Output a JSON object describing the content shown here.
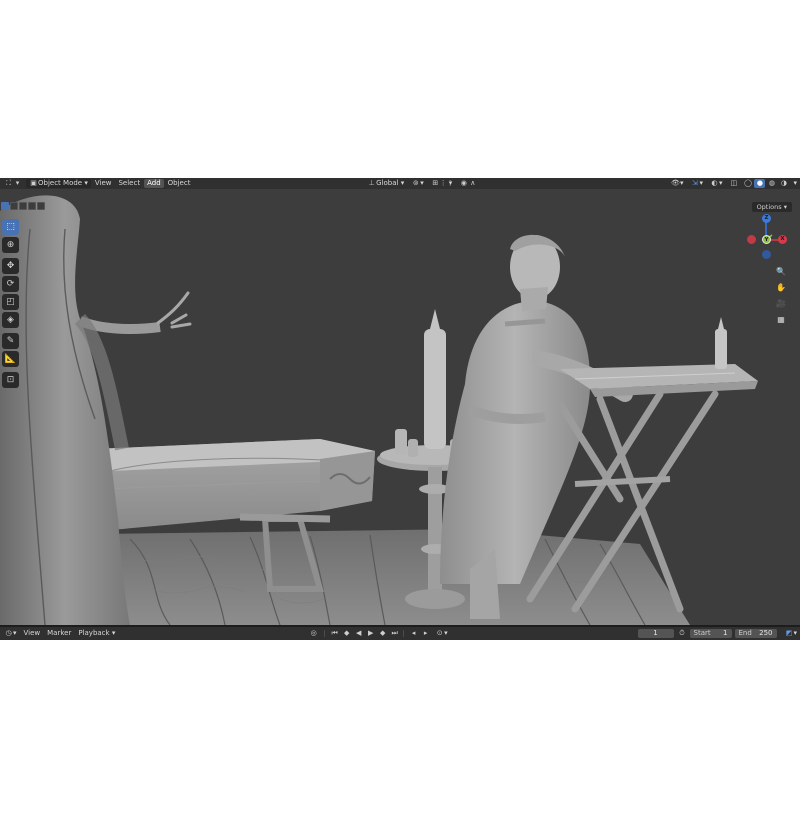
{
  "header": {
    "editor_type_icon": "editor-type-icon",
    "mode": "Object Mode",
    "menus": [
      "View",
      "Select",
      "Add",
      "Object"
    ],
    "active_menu": "Add",
    "transform_orientation": "Global"
  },
  "viewport": {
    "options_label": "Options",
    "gizmo": {
      "x": "X",
      "y": "Y",
      "z": "Z",
      "x_color": "#d83a4a",
      "y_color": "#8cc03c",
      "z_color": "#3a7ae0"
    }
  },
  "toolbar": {
    "tools": [
      "select-box",
      "cursor",
      "move",
      "rotate",
      "scale",
      "transform",
      "annotate",
      "measure",
      "add-cube"
    ],
    "active_tool": "select-box"
  },
  "timeline": {
    "menus": [
      "View",
      "Marker",
      "Playback"
    ],
    "current_frame": "1",
    "start_label": "Start",
    "start_value": "1",
    "end_label": "End",
    "end_value": "250"
  },
  "colors": {
    "accent": "#4772b3",
    "viewport_bg": "#3d3d3d",
    "header_bg": "#303030"
  }
}
